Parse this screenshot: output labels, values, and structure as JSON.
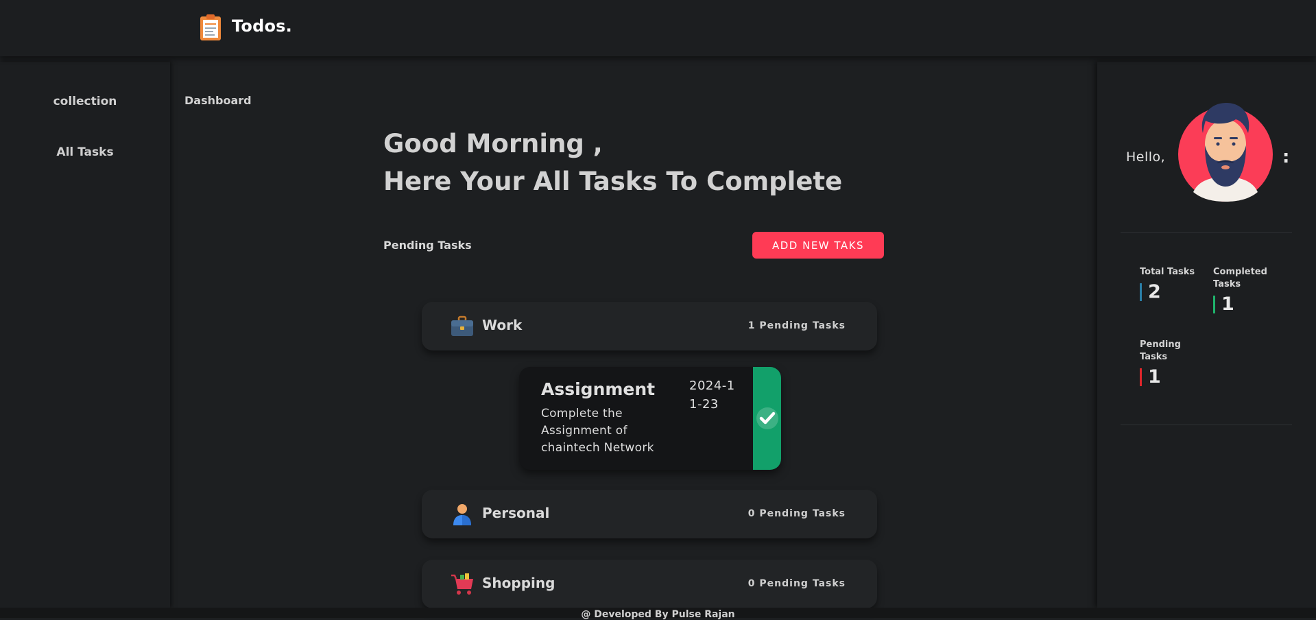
{
  "header": {
    "title": "Todos.",
    "logo_icon": "clipboard-todo-icon"
  },
  "sidebar": {
    "items": [
      {
        "label": "collection"
      },
      {
        "label": "All Tasks"
      }
    ]
  },
  "main": {
    "breadcrumb": "Dashboard",
    "greeting_line1": "Good Morning ,",
    "greeting_line2": "Here Your All Tasks To Complete",
    "section_title": "Pending Tasks",
    "add_button_label": "ADD NEW TAKS",
    "categories": [
      {
        "name": "Work",
        "count_label": "1 Pending Tasks",
        "icon": "briefcase-icon"
      },
      {
        "name": "Personal",
        "count_label": "0 Pending Tasks",
        "icon": "person-icon"
      },
      {
        "name": "Shopping",
        "count_label": "0 Pending Tasks",
        "icon": "shopping-cart-icon"
      }
    ],
    "task": {
      "title": "Assignment",
      "description": "Complete the Assignment of chaintech Network",
      "date": "2024-11-23",
      "status_icon": "check-icon"
    }
  },
  "right_panel": {
    "greeting": "Hello,",
    "menu_icon": ":",
    "stats": [
      {
        "label": "Total Tasks",
        "value": "2",
        "color": "#2a7fa8"
      },
      {
        "label": "Completed Tasks",
        "value": "1",
        "color": "#1fb36b"
      },
      {
        "label": "Pending Tasks",
        "value": "1",
        "color": "#e0262b"
      }
    ]
  },
  "footer": {
    "text": "@ Developed By Pulse Rajan"
  },
  "colors": {
    "accent": "#ff3b55",
    "success": "#12a06a",
    "background": "#1d1f21"
  }
}
